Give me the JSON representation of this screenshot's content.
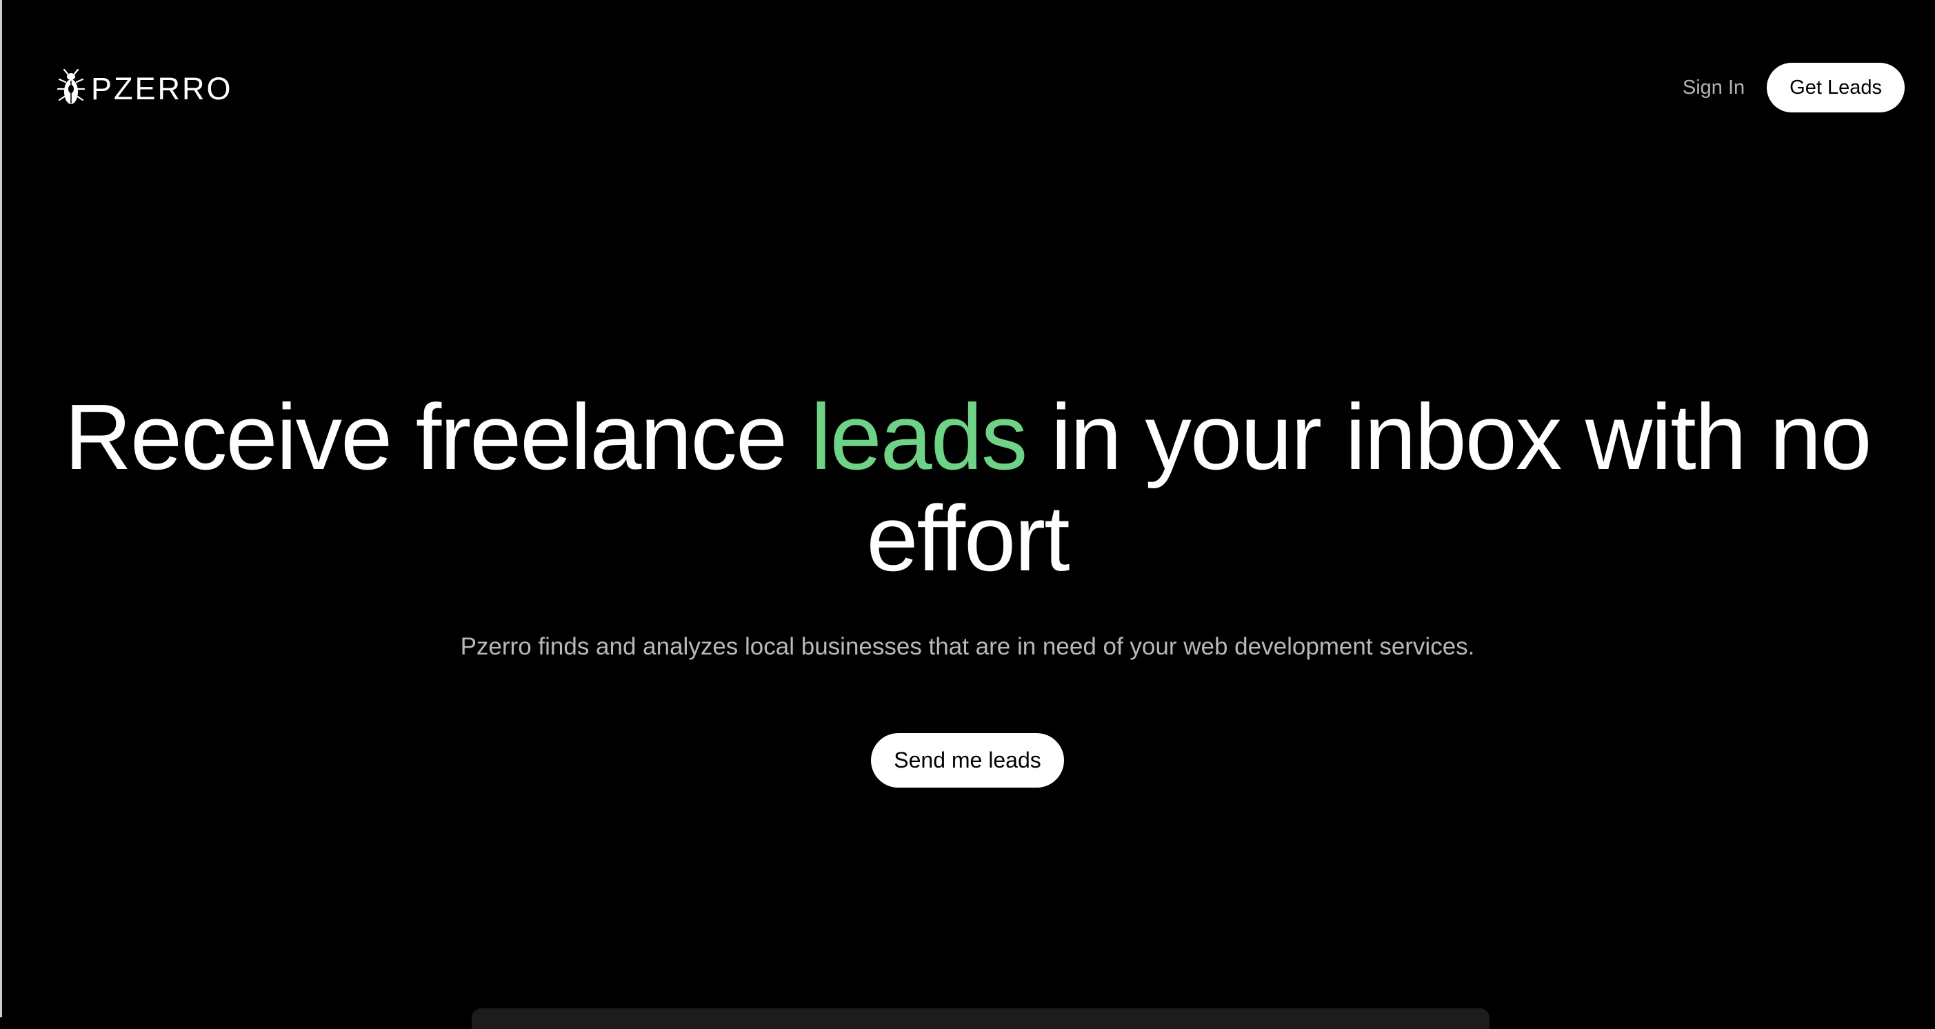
{
  "header": {
    "brand": "PZERRO",
    "logo_icon": "beetle-icon",
    "sign_in_label": "Sign In",
    "get_leads_label": "Get Leads"
  },
  "hero": {
    "title_part1": "Receive freelance ",
    "title_accent": "leads",
    "title_part2": " in your inbox with no effort",
    "subtitle": "Pzerro finds and analyzes local businesses that are in need of your web development services.",
    "cta_label": "Send me leads"
  },
  "colors": {
    "background": "#000000",
    "accent": "#6fd387",
    "button_bg": "#ffffff",
    "muted_text": "#b8b8b8"
  }
}
